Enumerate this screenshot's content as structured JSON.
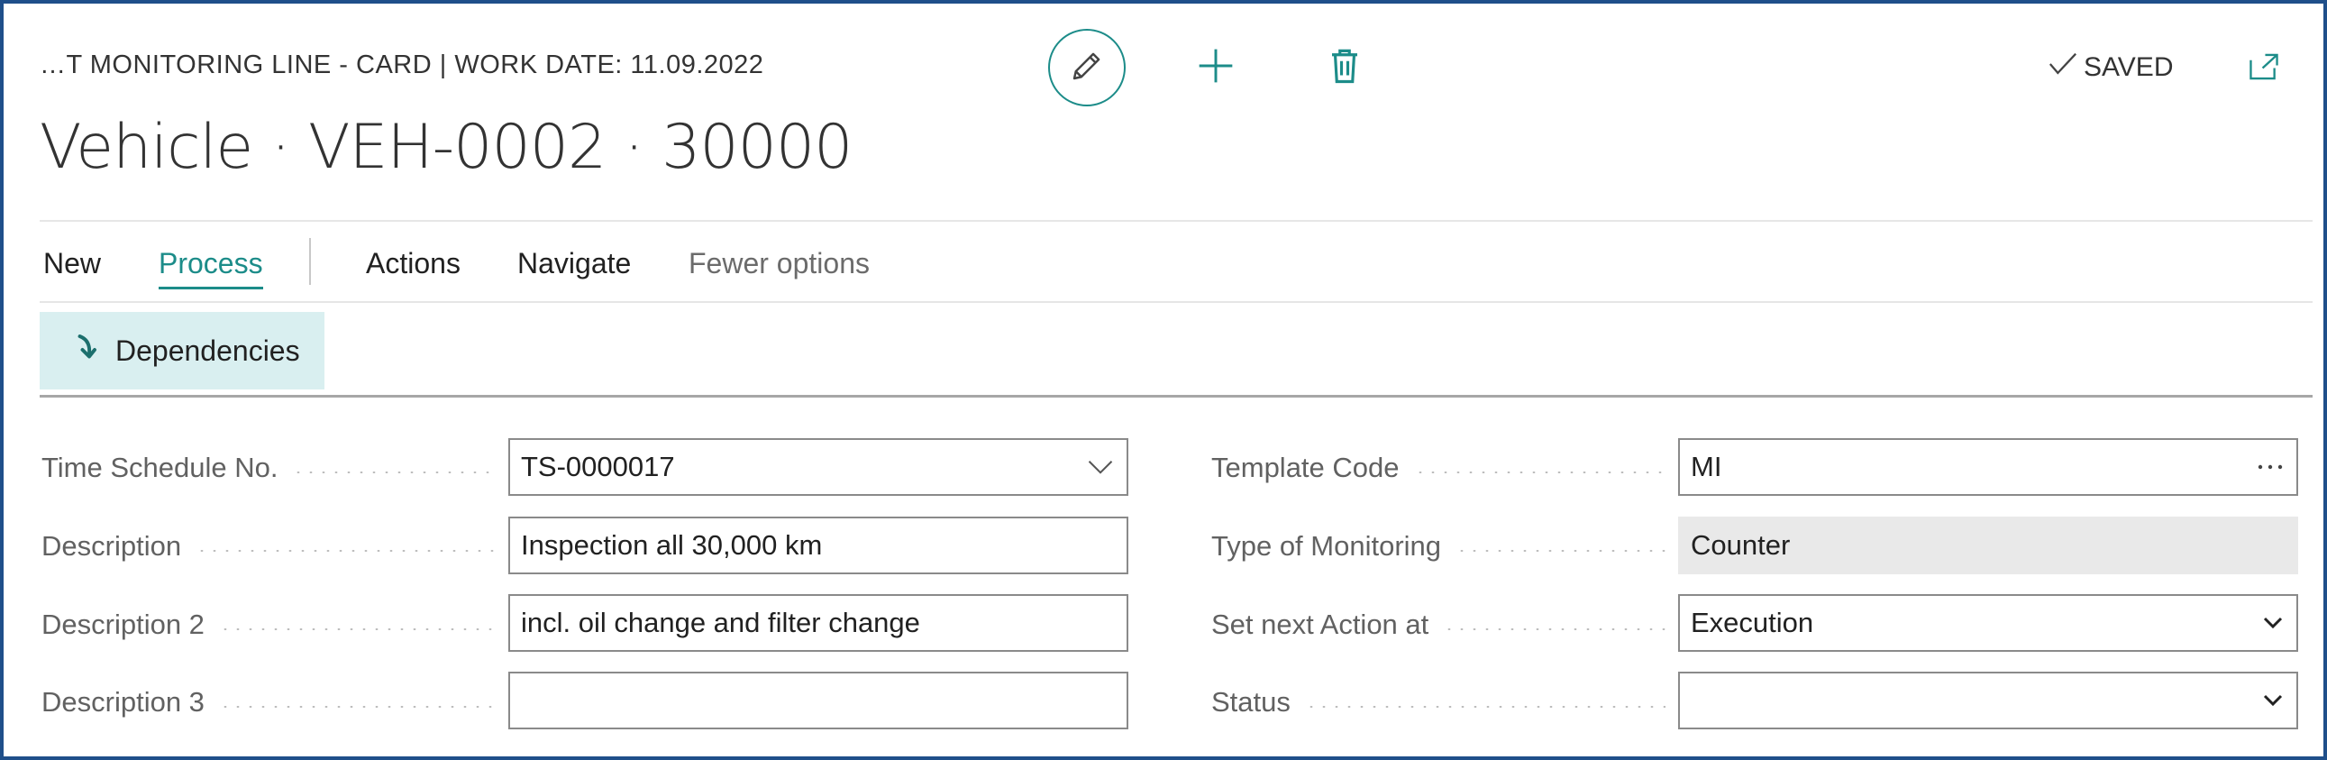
{
  "header": {
    "caption": "…T MONITORING LINE - CARD | WORK DATE: 11.09.2022",
    "title": "Vehicle · VEH-0002 · 30000",
    "saved_label": "SAVED"
  },
  "icons": {
    "edit": "pencil-icon",
    "new": "plus-icon",
    "delete": "trash-icon",
    "saved": "checkmark-icon",
    "open_new_window": "open-in-new-window-icon",
    "promo": "arrow-down-right-icon",
    "lookup": "ellipsis-icon",
    "dropdown": "chevron-down-icon"
  },
  "menu": {
    "new": "New",
    "process": "Process",
    "actions": "Actions",
    "navigate": "Navigate",
    "fewer": "Fewer options"
  },
  "promoted": {
    "dependencies": "Dependencies"
  },
  "left_fields": [
    {
      "label": "Time Schedule No.",
      "value": "TS-0000017"
    },
    {
      "label": "Description",
      "value": "Inspection all 30,000 km"
    },
    {
      "label": "Description 2",
      "value": "incl. oil change and filter change"
    },
    {
      "label": "Description 3",
      "value": ""
    }
  ],
  "right_fields": [
    {
      "label": "Template Code",
      "value": "MI"
    },
    {
      "label": "Type of Monitoring",
      "value": "Counter"
    },
    {
      "label": "Set next Action at",
      "value": "Execution"
    },
    {
      "label": "Status",
      "value": ""
    }
  ],
  "colors": {
    "accent": "#1c8c89",
    "border": "#1f4f8a",
    "promo_bg": "#d9eff0"
  }
}
